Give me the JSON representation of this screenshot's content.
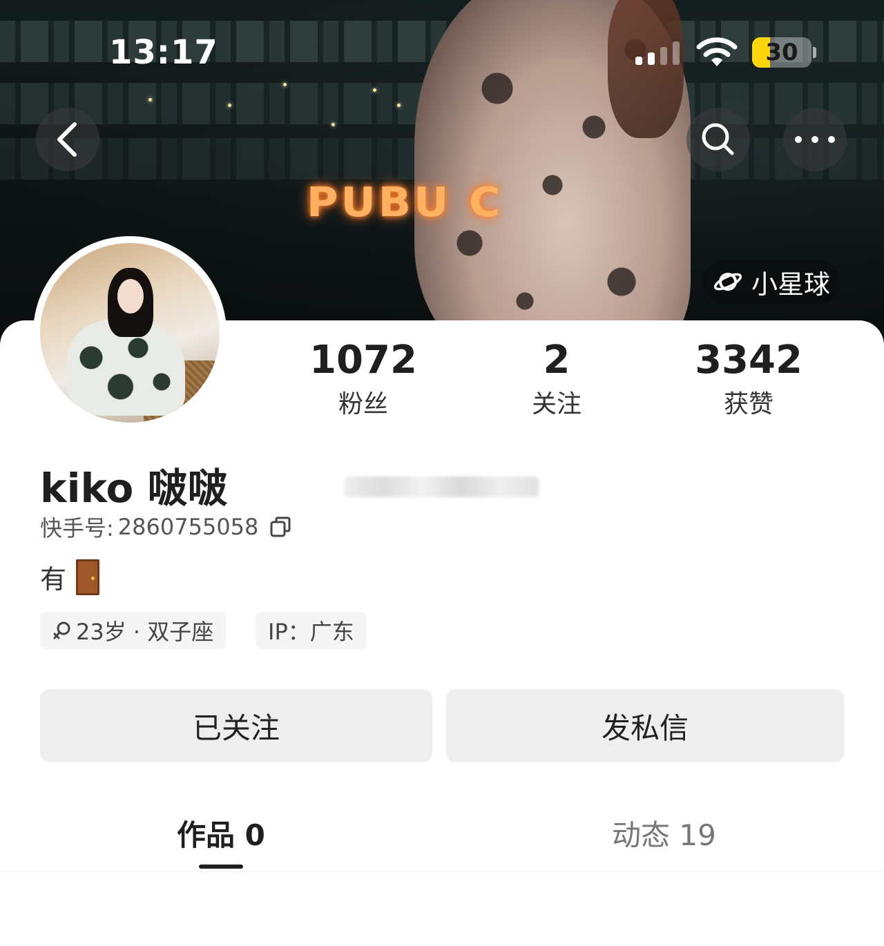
{
  "status_bar": {
    "time": "13:17",
    "battery": "30",
    "battery_level": 0.3
  },
  "cover": {
    "neon_sign": "PUBU C"
  },
  "planet_chip": {
    "label": "小星球",
    "icon": "planet-icon"
  },
  "nav": {
    "back_icon": "chevron-left-icon",
    "search_icon": "search-icon",
    "more_icon": "more-dots-icon"
  },
  "profile": {
    "name": "kiko 啵啵",
    "account_label": "快手号:",
    "account_id": "2860755058",
    "bio": "有"
  },
  "stats": [
    {
      "value": "1072",
      "label": "粉丝"
    },
    {
      "value": "2",
      "label": "关注"
    },
    {
      "value": "3342",
      "label": "获赞"
    }
  ],
  "tags": {
    "age_constellation": "23岁 · 双子座",
    "ip": "IP：广东"
  },
  "actions": {
    "following": "已关注",
    "message": "发私信"
  },
  "tabs": [
    {
      "label": "作品 0",
      "active": true
    },
    {
      "label": "动态 19",
      "active": false
    }
  ],
  "colors": {
    "neon": "#ffb060",
    "battery": "#ffd60a",
    "button_bg": "#eeeeee",
    "tab_indicator": "#1f1f1f"
  }
}
